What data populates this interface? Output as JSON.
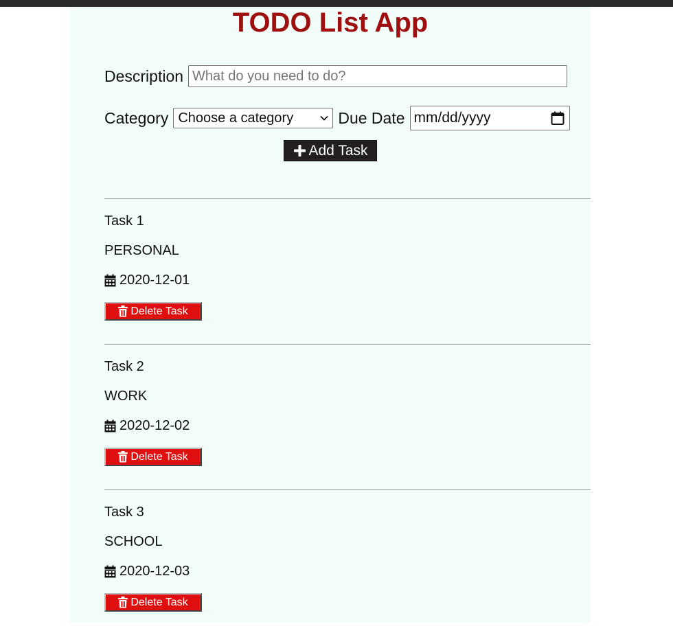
{
  "header": {
    "title": "TODO List App",
    "title_color": "#9e0f0f"
  },
  "form": {
    "description_label": "Description",
    "description_placeholder": "What do you need to do?",
    "description_value": "",
    "category_label": "Category",
    "category_selected": "Choose a category",
    "due_date_label": "Due Date",
    "due_date_value": "mm/dd/yyyy",
    "add_button_label": "Add Task",
    "add_button_icon": "plus-icon"
  },
  "tasks": [
    {
      "name": "Task 1",
      "category": "PERSONAL",
      "due_date": "2020-12-01",
      "delete_label": "Delete Task"
    },
    {
      "name": "Task 2",
      "category": "WORK",
      "due_date": "2020-12-02",
      "delete_label": "Delete Task"
    },
    {
      "name": "Task 3",
      "category": "SCHOOL",
      "due_date": "2020-12-03",
      "delete_label": "Delete Task"
    }
  ],
  "colors": {
    "page_background": "#f2fdfa",
    "delete_button": "#e01010",
    "add_button": "#231f20"
  }
}
